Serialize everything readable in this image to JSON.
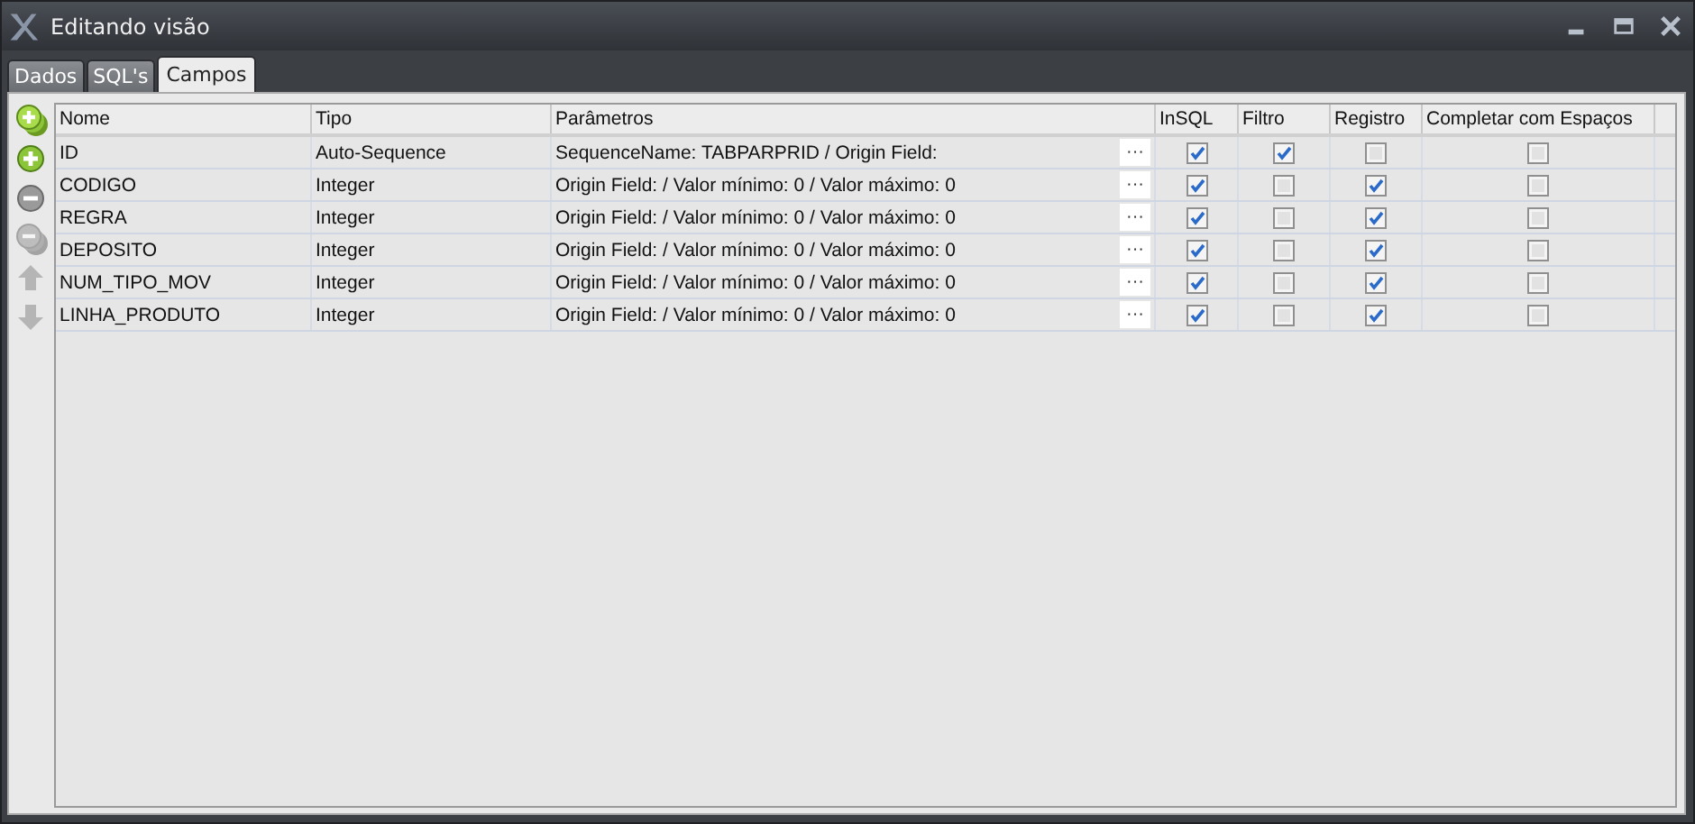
{
  "window": {
    "title": "Editando visão"
  },
  "tabs": [
    {
      "label": "Dados",
      "selected": false
    },
    {
      "label": "SQL's",
      "selected": false
    },
    {
      "label": "Campos",
      "selected": true
    }
  ],
  "toolbar": [
    {
      "kind": "add-many",
      "disabled": false
    },
    {
      "kind": "add",
      "disabled": false
    },
    {
      "kind": "remove",
      "disabled": false
    },
    {
      "kind": "remove-many",
      "disabled": true
    },
    {
      "kind": "up",
      "disabled": true
    },
    {
      "kind": "down",
      "disabled": true
    }
  ],
  "table": {
    "columns": [
      "Nome",
      "Tipo",
      "Parâmetros",
      "InSQL",
      "Filtro",
      "Registro",
      "Completar com Espaços"
    ],
    "rows": [
      {
        "nome": "ID",
        "tipo": "Auto-Sequence",
        "parametros": "SequenceName: TABPARPRID / Origin Field:",
        "button": "···",
        "insql": true,
        "filtro": true,
        "registro": false,
        "completar": false
      },
      {
        "nome": "CODIGO",
        "tipo": "Integer",
        "parametros": "Origin Field:  / Valor mínimo: 0 / Valor máximo: 0",
        "button": "···",
        "insql": true,
        "filtro": false,
        "registro": true,
        "completar": false
      },
      {
        "nome": "REGRA",
        "tipo": "Integer",
        "parametros": "Origin Field:  / Valor mínimo: 0 / Valor máximo: 0",
        "button": "···",
        "insql": true,
        "filtro": false,
        "registro": true,
        "completar": false
      },
      {
        "nome": "DEPOSITO",
        "tipo": "Integer",
        "parametros": "Origin Field:  / Valor mínimo: 0 / Valor máximo: 0",
        "button": "···",
        "insql": true,
        "filtro": false,
        "registro": true,
        "completar": false
      },
      {
        "nome": "NUM_TIPO_MOV",
        "tipo": "Integer",
        "parametros": "Origin Field:  / Valor mínimo: 0 / Valor máximo: 0",
        "button": "···",
        "insql": true,
        "filtro": false,
        "registro": true,
        "completar": false
      },
      {
        "nome": "LINHA_PRODUTO",
        "tipo": "Integer",
        "parametros": "Origin Field:  / Valor mínimo: 0 / Valor máximo: 0",
        "button": "···",
        "insql": true,
        "filtro": false,
        "registro": true,
        "completar": false
      }
    ]
  }
}
